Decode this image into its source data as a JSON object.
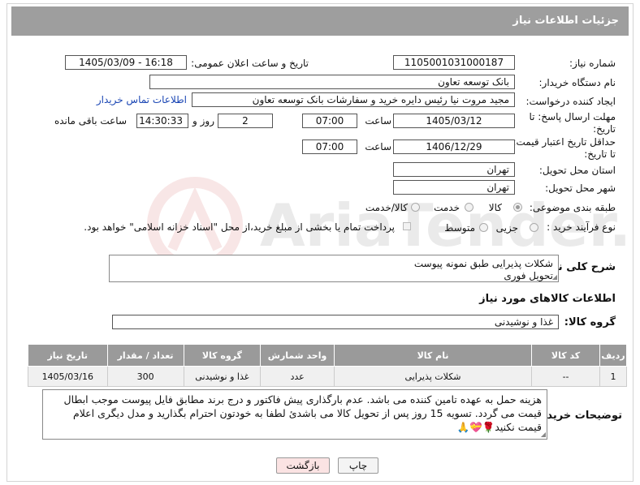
{
  "header": {
    "title": "جزئیات اطلاعات نیاز"
  },
  "fields": {
    "need_number_label": "شماره نیاز:",
    "need_number": "1105001031000187",
    "announce_label": "تاریخ و ساعت اعلان عمومی:",
    "announce_value": "1405/03/09 - 16:18",
    "buyer_label": "نام دستگاه خریدار:",
    "buyer_value": "بانک توسعه تعاون",
    "creator_label": "ایجاد کننده درخواست:",
    "creator_value": "مجید مروت نیا رئیس دایره خرید و سفارشات بانک توسعه تعاون",
    "contact_link": "اطلاعات تماس خریدار",
    "deadline_label_1": "مهلت ارسال پاسخ: تا",
    "deadline_label_2": "تاریخ:",
    "deadline_date": "1405/03/12",
    "hour_label": "ساعت",
    "deadline_time": "07:00",
    "days_value": "2",
    "days_label": "روز و",
    "remaining_time": "14:30:33",
    "remaining_label": "ساعت باقی مانده",
    "validity_label_1": "حداقل تاریخ اعتبار قیمت:",
    "validity_label_2": "تا تاریخ:",
    "validity_date": "1406/12/29",
    "validity_hour_label": "ساعت",
    "validity_time": "07:00",
    "province_label": "استان محل تحویل:",
    "province_value": "تهران",
    "city_label": "شهر محل تحویل:",
    "city_value": "تهران",
    "category_label": "طبقه بندی موضوعی:",
    "category_options": [
      "کالا",
      "خدمت",
      "کالا/خدمت"
    ],
    "process_label": "نوع فرآیند خرید :",
    "process_options": [
      "جزیی",
      "متوسط"
    ],
    "payment_note": "پرداخت تمام یا بخشی از مبلغ خرید،از محل \"اسناد خزانه اسلامی\" خواهد بود."
  },
  "summary": {
    "label": "شرح کلی نیاز:",
    "line1": "شکلات پذیرایی طبق نمونه پیوست",
    "line2": "تحویل فوری"
  },
  "goods_section": {
    "title": "اطلاعات کالاهای مورد نیاز",
    "group_label": "گروه کالا:",
    "group_value": "غذا و نوشیدنی"
  },
  "table": {
    "headers": [
      "ردیف",
      "کد کالا",
      "نام کالا",
      "واحد شمارش",
      "گروه کالا",
      "تعداد / مقدار",
      "تاریخ نیاز"
    ],
    "rows": [
      [
        "1",
        "--",
        "شکلات پذیرایی",
        "عدد",
        "غذا و نوشیدنی",
        "300",
        "1405/03/16"
      ]
    ]
  },
  "buyer_notes": {
    "label": "توضیحات خریدار:",
    "text": "هزینه حمل به عهده تامین کننده می باشد. عدم بارگذاری پیش فاکتور و درج برند مطابق فایل پیوست موجب ابطال قیمت می گردد. تسویه 15 روز پس از تحویل کالا می باشدئ لطفا به خودتون احترام بگذارید و مدل دیگری اعلام قیمت نکنید🌹💝🙏"
  },
  "buttons": {
    "print": "چاپ",
    "back": "بازگشت"
  },
  "colors": {
    "header_bg": "#9e9e9e",
    "link": "#1a46b4",
    "back_button_bg": "#fbe3e3"
  }
}
